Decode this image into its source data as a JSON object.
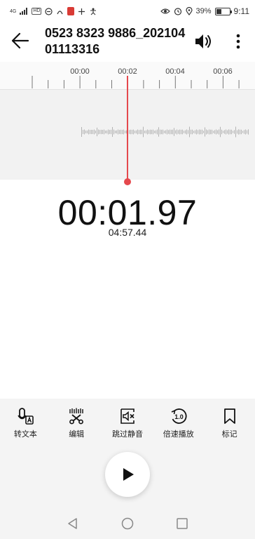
{
  "status_bar": {
    "left_icons": [
      "signal-4g-icon",
      "hd-icon",
      "vpn-icon",
      "nfc-icon",
      "recording-icon",
      "data-icon",
      "accessibility-icon"
    ],
    "signal_label": "4G",
    "hd_label": "HD",
    "right_icons": [
      "eye-icon",
      "alarm-icon",
      "location-icon",
      "battery-icon"
    ],
    "battery": "39%",
    "time": "9:11"
  },
  "header": {
    "title": "0523 8323 9886_20210401113316"
  },
  "timeline": {
    "ruler_labels": [
      "00:00",
      "00:02",
      "00:04",
      "00:06"
    ]
  },
  "player": {
    "current_time": "00:01.97",
    "total_time": "04:57.44"
  },
  "toolbar": {
    "items": [
      {
        "label": "转文本",
        "icon": "speech-to-text-icon"
      },
      {
        "label": "编辑",
        "icon": "scissors-icon"
      },
      {
        "label": "跳过静音",
        "icon": "skip-silence-icon"
      },
      {
        "label": "倍速播放",
        "icon": "playback-speed-icon"
      },
      {
        "label": "标记",
        "icon": "bookmark-icon"
      }
    ],
    "speed_value": "1.0"
  },
  "colors": {
    "accent": "#e5484d",
    "timeline_bg": "#f2f2f2",
    "toolbar_bg": "#f4f4f4"
  }
}
